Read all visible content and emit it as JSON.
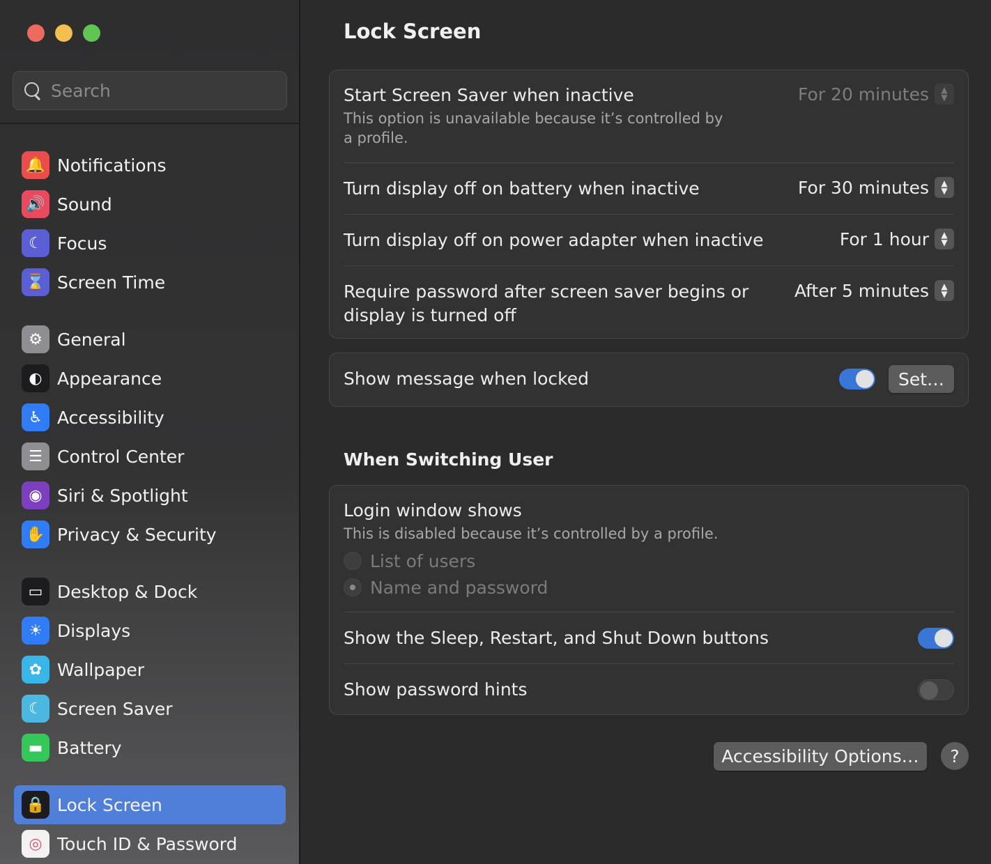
{
  "window": {
    "title": "Lock Screen"
  },
  "search": {
    "placeholder": "Search"
  },
  "sidebar": {
    "groups": [
      [
        {
          "label": "Notifications",
          "icon": "bell-icon",
          "color": "#eb4d4d"
        },
        {
          "label": "Sound",
          "icon": "speaker-icon",
          "color": "#e94a5f"
        },
        {
          "label": "Focus",
          "icon": "moon-icon",
          "color": "#5b5fd6"
        },
        {
          "label": "Screen Time",
          "icon": "hourglass-icon",
          "color": "#5b5fd6"
        }
      ],
      [
        {
          "label": "General",
          "icon": "gear-icon",
          "color": "#8e8e93"
        },
        {
          "label": "Appearance",
          "icon": "appearance-icon",
          "color": "#1c1c1e"
        },
        {
          "label": "Accessibility",
          "icon": "accessibility-icon",
          "color": "#2f7cf6"
        },
        {
          "label": "Control Center",
          "icon": "control-center-icon",
          "color": "#8e8e93"
        },
        {
          "label": "Siri & Spotlight",
          "icon": "siri-icon",
          "color": "#7b3fbf"
        },
        {
          "label": "Privacy & Security",
          "icon": "hand-icon",
          "color": "#2f7cf6"
        }
      ],
      [
        {
          "label": "Desktop & Dock",
          "icon": "dock-icon",
          "color": "#1c1c1e"
        },
        {
          "label": "Displays",
          "icon": "sun-icon",
          "color": "#2f7cf6"
        },
        {
          "label": "Wallpaper",
          "icon": "flower-icon",
          "color": "#38b6e8"
        },
        {
          "label": "Screen Saver",
          "icon": "screen-saver-icon",
          "color": "#4cb8e0"
        },
        {
          "label": "Battery",
          "icon": "battery-icon",
          "color": "#34c759"
        }
      ],
      [
        {
          "label": "Lock Screen",
          "icon": "lock-icon",
          "color": "#1c1c1e",
          "selected": true
        },
        {
          "label": "Touch ID & Password",
          "icon": "fingerprint-icon",
          "color": "#f2f2f2"
        }
      ]
    ]
  },
  "main": {
    "title": "Lock Screen",
    "screen_saver": {
      "label": "Start Screen Saver when inactive",
      "note": "This option is unavailable because it’s controlled by a profile.",
      "value": "For 20 minutes"
    },
    "display_off_battery": {
      "label": "Turn display off on battery when inactive",
      "value": "For 30 minutes"
    },
    "display_off_power": {
      "label": "Turn display off on power adapter when inactive",
      "value": "For 1 hour"
    },
    "require_password": {
      "label": "Require password after screen saver begins or display is turned off",
      "value": "After 5 minutes"
    },
    "show_message": {
      "label": "Show message when locked",
      "on": true,
      "button": "Set…"
    },
    "switching_title": "When Switching User",
    "login_window": {
      "label": "Login window shows",
      "note": "This is disabled because it’s controlled by a profile.",
      "options": [
        "List of users",
        "Name and password"
      ],
      "selected": "Name and password"
    },
    "show_sleep_buttons": {
      "label": "Show the Sleep, Restart, and Shut Down buttons",
      "on": true
    },
    "show_hints": {
      "label": "Show password hints",
      "on": false
    },
    "accessibility_button": "Accessibility Options…",
    "help_label": "?"
  },
  "colors": {
    "accent": "#4f7fd8",
    "toggle_on": "#3a76d6"
  }
}
